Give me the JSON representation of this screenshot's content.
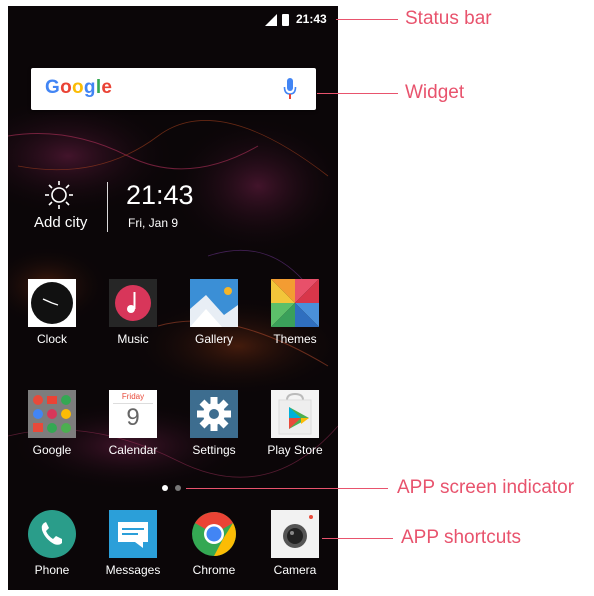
{
  "status_bar": {
    "time": "21:43"
  },
  "search_widget": {
    "logo": "Google",
    "mic_icon": "mic-icon"
  },
  "weather": {
    "icon": "sun-icon",
    "city_label": "Add city"
  },
  "clock": {
    "time": "21:43",
    "date": "Fri, Jan 9"
  },
  "apps_row1": [
    {
      "label": "Clock",
      "icon": "clock-icon"
    },
    {
      "label": "Music",
      "icon": "music-icon"
    },
    {
      "label": "Gallery",
      "icon": "gallery-icon"
    },
    {
      "label": "Themes",
      "icon": "themes-icon"
    }
  ],
  "apps_row2": [
    {
      "label": "Google",
      "icon": "google-folder-icon"
    },
    {
      "label": "Calendar",
      "icon": "calendar-icon",
      "day": "Friday",
      "date": "9"
    },
    {
      "label": "Settings",
      "icon": "settings-icon"
    },
    {
      "label": "Play Store",
      "icon": "play-store-icon"
    }
  ],
  "page_indicator": {
    "pages": 2,
    "active": 0
  },
  "dock": [
    {
      "label": "Phone",
      "icon": "phone-icon"
    },
    {
      "label": "Messages",
      "icon": "messages-icon"
    },
    {
      "label": "Chrome",
      "icon": "chrome-icon"
    },
    {
      "label": "Camera",
      "icon": "camera-icon"
    }
  ],
  "callouts": {
    "status_bar": "Status bar",
    "widget": "Widget",
    "screen_indicator": "APP screen indicator",
    "shortcuts": "APP shortcuts"
  },
  "colors": {
    "callout": "#e8536d",
    "wallpaper": "#0b0608"
  }
}
